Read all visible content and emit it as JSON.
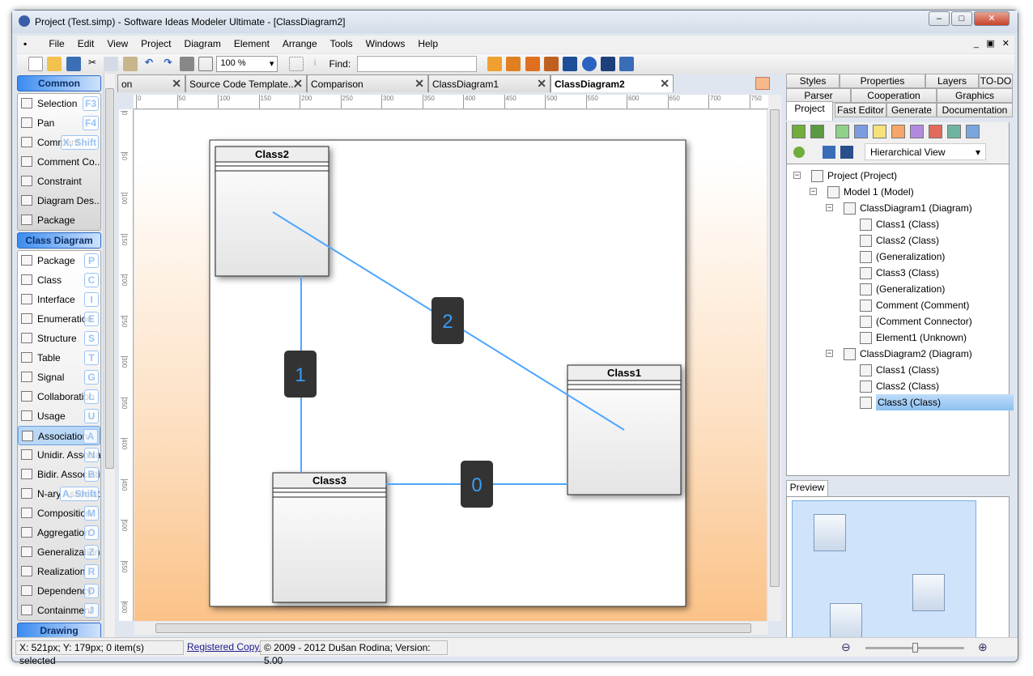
{
  "window": {
    "title": "Project (Test.simp)  - Software Ideas Modeler Ultimate - [ClassDiagram2]"
  },
  "menu": [
    "File",
    "Edit",
    "View",
    "Project",
    "Diagram",
    "Element",
    "Arrange",
    "Tools",
    "Windows",
    "Help"
  ],
  "toolbar": {
    "zoom": "100 %",
    "find_label": "Find:",
    "find_value": ""
  },
  "toolbox": {
    "groups": [
      {
        "label": "Common",
        "items": [
          {
            "label": "Selection",
            "key": "F3"
          },
          {
            "label": "Pan",
            "key": "F4"
          },
          {
            "label": "Comment",
            "key": "X, Shift"
          },
          {
            "label": "Comment  Co...",
            "key": ""
          },
          {
            "label": "Constraint",
            "key": ""
          },
          {
            "label": "Diagram Des...",
            "key": ""
          },
          {
            "label": "Package",
            "key": ""
          }
        ]
      },
      {
        "label": "Class Diagram",
        "items": [
          {
            "label": "Package",
            "key": "P"
          },
          {
            "label": "Class",
            "key": "C"
          },
          {
            "label": "Interface",
            "key": "I"
          },
          {
            "label": "Enumeration",
            "key": "E"
          },
          {
            "label": "Structure",
            "key": "S"
          },
          {
            "label": "Table",
            "key": "T"
          },
          {
            "label": "Signal",
            "key": "G"
          },
          {
            "label": "Collaboration",
            "key": "L"
          },
          {
            "label": "Usage",
            "key": "U"
          },
          {
            "label": "Association",
            "key": "A"
          },
          {
            "label": "Unidir. Association",
            "key": "N"
          },
          {
            "label": "Bidir. Association",
            "key": "B"
          },
          {
            "label": "N-ary Association",
            "key": "A, Shift"
          },
          {
            "label": "Composition",
            "key": "M"
          },
          {
            "label": "Aggregation",
            "key": "O"
          },
          {
            "label": "Generalization",
            "key": "Z"
          },
          {
            "label": "Realization",
            "key": "R"
          },
          {
            "label": "Dependency",
            "key": "D"
          },
          {
            "label": "Containment",
            "key": "J"
          }
        ]
      },
      {
        "label": "Drawing",
        "items": []
      }
    ],
    "selected": "Association"
  },
  "doc_tabs": [
    {
      "label": "on"
    },
    {
      "label": "Source Code Template..."
    },
    {
      "label": "Comparison"
    },
    {
      "label": "ClassDiagram1"
    },
    {
      "label": "ClassDiagram2",
      "active": true
    }
  ],
  "ruler": {
    "top": [
      "0",
      "50",
      "100",
      "150",
      "200",
      "250",
      "300",
      "350",
      "400",
      "450",
      "500",
      "550",
      "600",
      "650",
      "700",
      "750"
    ],
    "left": [
      "0",
      "50",
      "100",
      "150",
      "200",
      "250",
      "300",
      "350",
      "400",
      "450",
      "500",
      "550",
      "600"
    ]
  },
  "diagram": {
    "classes": [
      {
        "name": "Class2"
      },
      {
        "name": "Class1"
      },
      {
        "name": "Class3"
      }
    ],
    "connectors": [
      {
        "label": "2",
        "from": "Class2",
        "to": "Class1"
      },
      {
        "label": "1",
        "from": "Class2",
        "to": "Class3"
      },
      {
        "label": "0",
        "from": "Class3",
        "to": "Class1"
      }
    ],
    "line_color": "#4da6ff"
  },
  "right_panel": {
    "tabs_row1": [
      "Styles",
      "Properties",
      "Layers",
      "TO-DO"
    ],
    "tabs_row2": [
      "Parser",
      "Cooperation",
      "Graphics"
    ],
    "tabs_row3": [
      "Project",
      "Fast Editor",
      "Generate",
      "Documentation"
    ],
    "active_tab": "Project",
    "view_mode": "Hierarchical View",
    "tree": [
      {
        "label": "Project (Project)",
        "level": 0,
        "expander": "−"
      },
      {
        "label": "Model 1 (Model)",
        "level": 1,
        "expander": "−"
      },
      {
        "label": "ClassDiagram1 (Diagram)",
        "level": 2,
        "expander": "−"
      },
      {
        "label": "Class1 (Class)",
        "level": 3
      },
      {
        "label": "Class2 (Class)",
        "level": 3
      },
      {
        "label": "(Generalization)",
        "level": 3
      },
      {
        "label": "Class3 (Class)",
        "level": 3
      },
      {
        "label": "(Generalization)",
        "level": 3
      },
      {
        "label": "Comment (Comment)",
        "level": 3
      },
      {
        "label": "(Comment Connector)",
        "level": 3
      },
      {
        "label": "Element1 (Unknown)",
        "level": 3
      },
      {
        "label": "ClassDiagram2 (Diagram)",
        "level": 2,
        "expander": "−"
      },
      {
        "label": "Class1 (Class)",
        "level": 3
      },
      {
        "label": "Class2 (Class)",
        "level": 3
      },
      {
        "label": "Class3 (Class)",
        "level": 3,
        "selected": true
      }
    ],
    "preview_tab": "Preview"
  },
  "status": {
    "coords": "X: 521px; Y: 179px; 0 item(s) selected",
    "link": "Registered Copy.",
    "copyright": "© 2009 - 2012 Dušan Rodina; Version: 5.00"
  }
}
